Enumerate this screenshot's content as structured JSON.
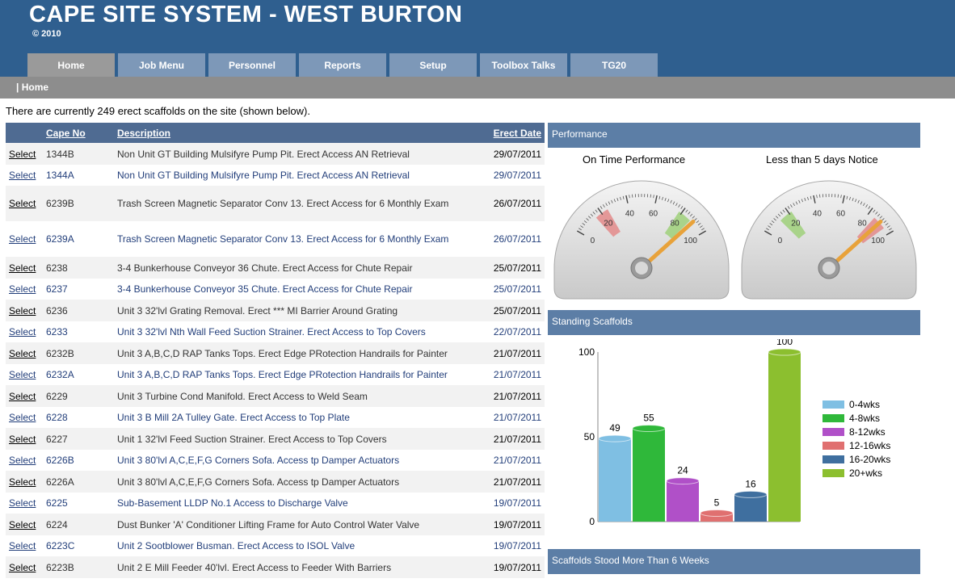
{
  "header": {
    "title": "CAPE SITE SYSTEM - WEST BURTON",
    "copyright": "© 2010"
  },
  "tabs": [
    {
      "label": "Home",
      "active": true
    },
    {
      "label": "Job Menu"
    },
    {
      "label": "Personnel"
    },
    {
      "label": "Reports"
    },
    {
      "label": "Setup"
    },
    {
      "label": "Toolbox Talks"
    },
    {
      "label": "TG20"
    }
  ],
  "breadcrumb": "| Home",
  "summary": "There are currently 249 erect scaffolds on the site (shown below).",
  "table": {
    "headers": {
      "cape_no": "Cape No",
      "description": "Description",
      "erect_date": "Erect Date"
    },
    "select_label": "Select",
    "rows": [
      {
        "cape_no": "1344B",
        "description": "Non Unit GT Building Mulsifyre Pump Pit. Erect Access AN Retrieval",
        "erect_date": "29/07/2011"
      },
      {
        "cape_no": "1344A",
        "description": "Non Unit GT Building Mulsifyre Pump Pit. Erect Access AN Retrieval",
        "erect_date": "29/07/2011"
      },
      {
        "cape_no": "6239B",
        "description": "Trash Screen Magnetic Separator Conv 13. Erect Access for 6 Monthly Exam",
        "erect_date": "26/07/2011"
      },
      {
        "cape_no": "6239A",
        "description": "Trash Screen Magnetic Separator Conv 13. Erect Access for 6 Monthly Exam",
        "erect_date": "26/07/2011"
      },
      {
        "cape_no": "6238",
        "description": "3-4 Bunkerhouse Conveyor 36 Chute. Erect Access for Chute Repair",
        "erect_date": "25/07/2011"
      },
      {
        "cape_no": "6237",
        "description": "3-4 Bunkerhouse Conveyor 35 Chute. Erect Access for Chute Repair",
        "erect_date": "25/07/2011"
      },
      {
        "cape_no": "6236",
        "description": "Unit 3 32'lvl Grating Removal. Erect *** MI Barrier Around Grating",
        "erect_date": "25/07/2011"
      },
      {
        "cape_no": "6233",
        "description": "Unit 3 32'lvl Nth Wall Feed Suction Strainer. Erect Access to Top Covers",
        "erect_date": "22/07/2011"
      },
      {
        "cape_no": "6232B",
        "description": "Unit 3 A,B,C,D RAP Tanks Tops. Erect Edge PRotection Handrails for Painter",
        "erect_date": "21/07/2011"
      },
      {
        "cape_no": "6232A",
        "description": "Unit 3 A,B,C,D RAP Tanks Tops. Erect Edge PRotection Handrails for Painter",
        "erect_date": "21/07/2011"
      },
      {
        "cape_no": "6229",
        "description": "Unit 3 Turbine Cond Manifold. Erect Access to Weld Seam",
        "erect_date": "21/07/2011"
      },
      {
        "cape_no": "6228",
        "description": "Unit 3 B Mill 2A Tulley Gate. Erect Access to Top Plate",
        "erect_date": "21/07/2011"
      },
      {
        "cape_no": "6227",
        "description": "Unit 1 32'lvl Feed Suction Strainer. Erect Access to Top Covers",
        "erect_date": "21/07/2011"
      },
      {
        "cape_no": "6226B",
        "description": "Unit 3 80'lvl A,C,E,F,G Corners Sofa. Access tp Damper Actuators",
        "erect_date": "21/07/2011"
      },
      {
        "cape_no": "6226A",
        "description": "Unit 3 80'lvl A,C,E,F,G Corners Sofa. Access tp Damper Actuators",
        "erect_date": "21/07/2011"
      },
      {
        "cape_no": "6225",
        "description": "Sub-Basement LLDP No.1 Access to Discharge Valve",
        "erect_date": "19/07/2011"
      },
      {
        "cape_no": "6224",
        "description": "Dust Bunker 'A' Conditioner Lifting Frame for Auto Control Water Valve",
        "erect_date": "19/07/2011"
      },
      {
        "cape_no": "6223C",
        "description": "Unit 2 Sootblower Busman. Erect Access to ISOL Valve",
        "erect_date": "19/07/2011"
      },
      {
        "cape_no": "6223B",
        "description": "Unit 2 E Mill Feeder 40'lvl. Erect Access to Feeder With Barriers",
        "erect_date": "19/07/2011"
      }
    ]
  },
  "performance": {
    "title": "Performance",
    "gauges": [
      {
        "title": "On Time Performance",
        "value": 90,
        "band_low": [
          15,
          25
        ],
        "band_high": [
          78,
          88
        ],
        "low_color": "#e38a8a",
        "high_color": "#9fd07a"
      },
      {
        "title": "Less than 5 days Notice",
        "value": 90,
        "band_low": [
          12,
          22
        ],
        "band_high": [
          85,
          95
        ],
        "low_color": "#9fd07a",
        "high_color": "#e38a8a"
      }
    ],
    "tick_labels": [
      "0",
      "20",
      "40",
      "60",
      "80",
      "100"
    ]
  },
  "standing": {
    "title": "Standing Scaffolds",
    "chart_data": {
      "type": "bar",
      "categories": [
        "0-4wks",
        "4-8wks",
        "8-12wks",
        "12-16wks",
        "16-20wks",
        "20+wks"
      ],
      "values": [
        49,
        55,
        24,
        5,
        16,
        100
      ],
      "colors": [
        "#7fbfe3",
        "#2fb83a",
        "#b050c8",
        "#e07070",
        "#3f6f9f",
        "#8cbf2f"
      ],
      "ylim": [
        0,
        100
      ],
      "yticks": [
        "0",
        "50",
        "100"
      ],
      "legend": "right"
    }
  },
  "weeks6": {
    "title": "Scaffolds Stood More Than 6 Weeks"
  }
}
